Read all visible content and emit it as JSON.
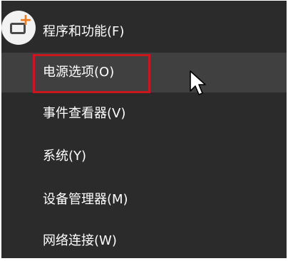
{
  "menu": {
    "items": [
      {
        "label": "程序和功能(F)"
      },
      {
        "label": "电源选项(O)"
      },
      {
        "label": "事件查看器(V)"
      },
      {
        "label": "系统(Y)"
      },
      {
        "label": "设备管理器(M)"
      },
      {
        "label": "网络连接(W)"
      }
    ]
  },
  "colors": {
    "menu_background": "#2b2b2b",
    "hover_background": "#404040",
    "highlight_border": "#c8181e",
    "icon_accent": "#f07a1e"
  },
  "icons": {
    "app_badge": "add-app-icon",
    "pointer": "mouse-cursor-icon"
  }
}
